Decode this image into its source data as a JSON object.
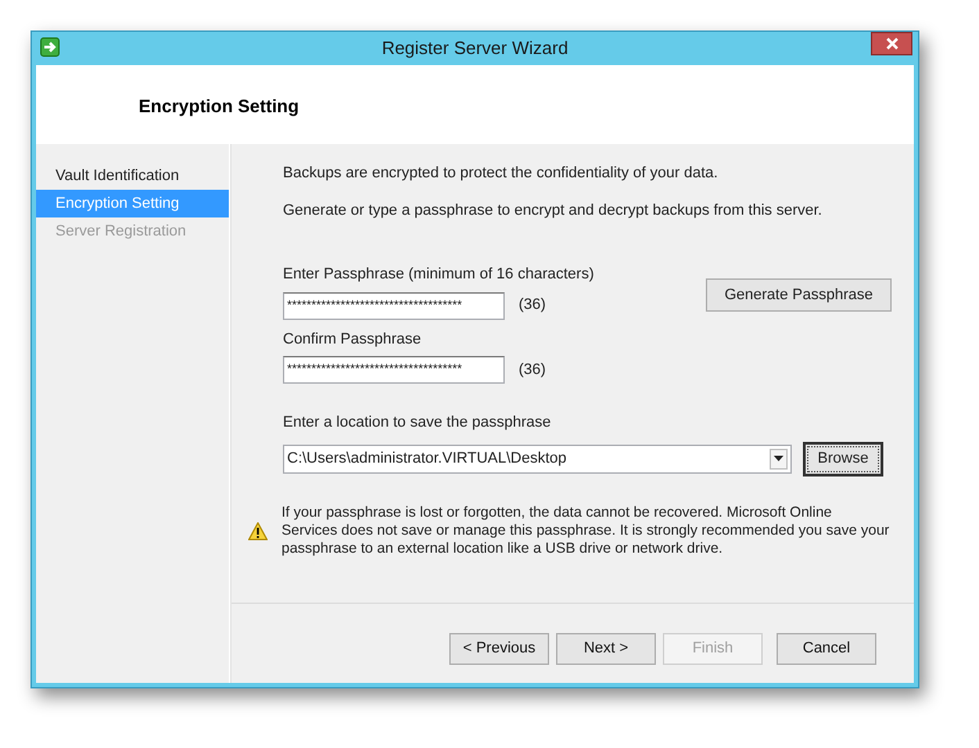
{
  "window": {
    "title": "Register Server Wizard"
  },
  "header": {
    "title": "Encryption Setting"
  },
  "sidebar": {
    "items": [
      {
        "label": "Vault Identification",
        "selected": false,
        "disabled": false
      },
      {
        "label": "Encryption Setting",
        "selected": true,
        "disabled": false
      },
      {
        "label": "Server Registration",
        "selected": false,
        "disabled": true
      }
    ]
  },
  "content": {
    "intro": [
      "Backups are encrypted to protect the confidentiality of your data.",
      "Generate or type a passphrase to encrypt and decrypt backups from this server."
    ],
    "passphrase": {
      "label": "Enter Passphrase (minimum of 16 characters)",
      "value": "************************************",
      "count": "(36)"
    },
    "generate_button": "Generate Passphrase",
    "confirm": {
      "label": "Confirm Passphrase",
      "value": "************************************",
      "count": "(36)"
    },
    "location": {
      "label": "Enter a location to save the passphrase",
      "value": "C:\\Users\\administrator.VIRTUAL\\Desktop"
    },
    "browse_button": "Browse",
    "warning": "If your passphrase is lost or forgotten, the data cannot be recovered. Microsoft Online Services does not save or manage this passphrase. It is strongly recommended you save your passphrase to an external location like a USB drive or network drive."
  },
  "buttons": [
    {
      "label": "< Previous",
      "disabled": false
    },
    {
      "label": "Next >",
      "disabled": false
    },
    {
      "label": "Finish",
      "disabled": true
    },
    {
      "label": "Cancel",
      "disabled": false
    }
  ]
}
